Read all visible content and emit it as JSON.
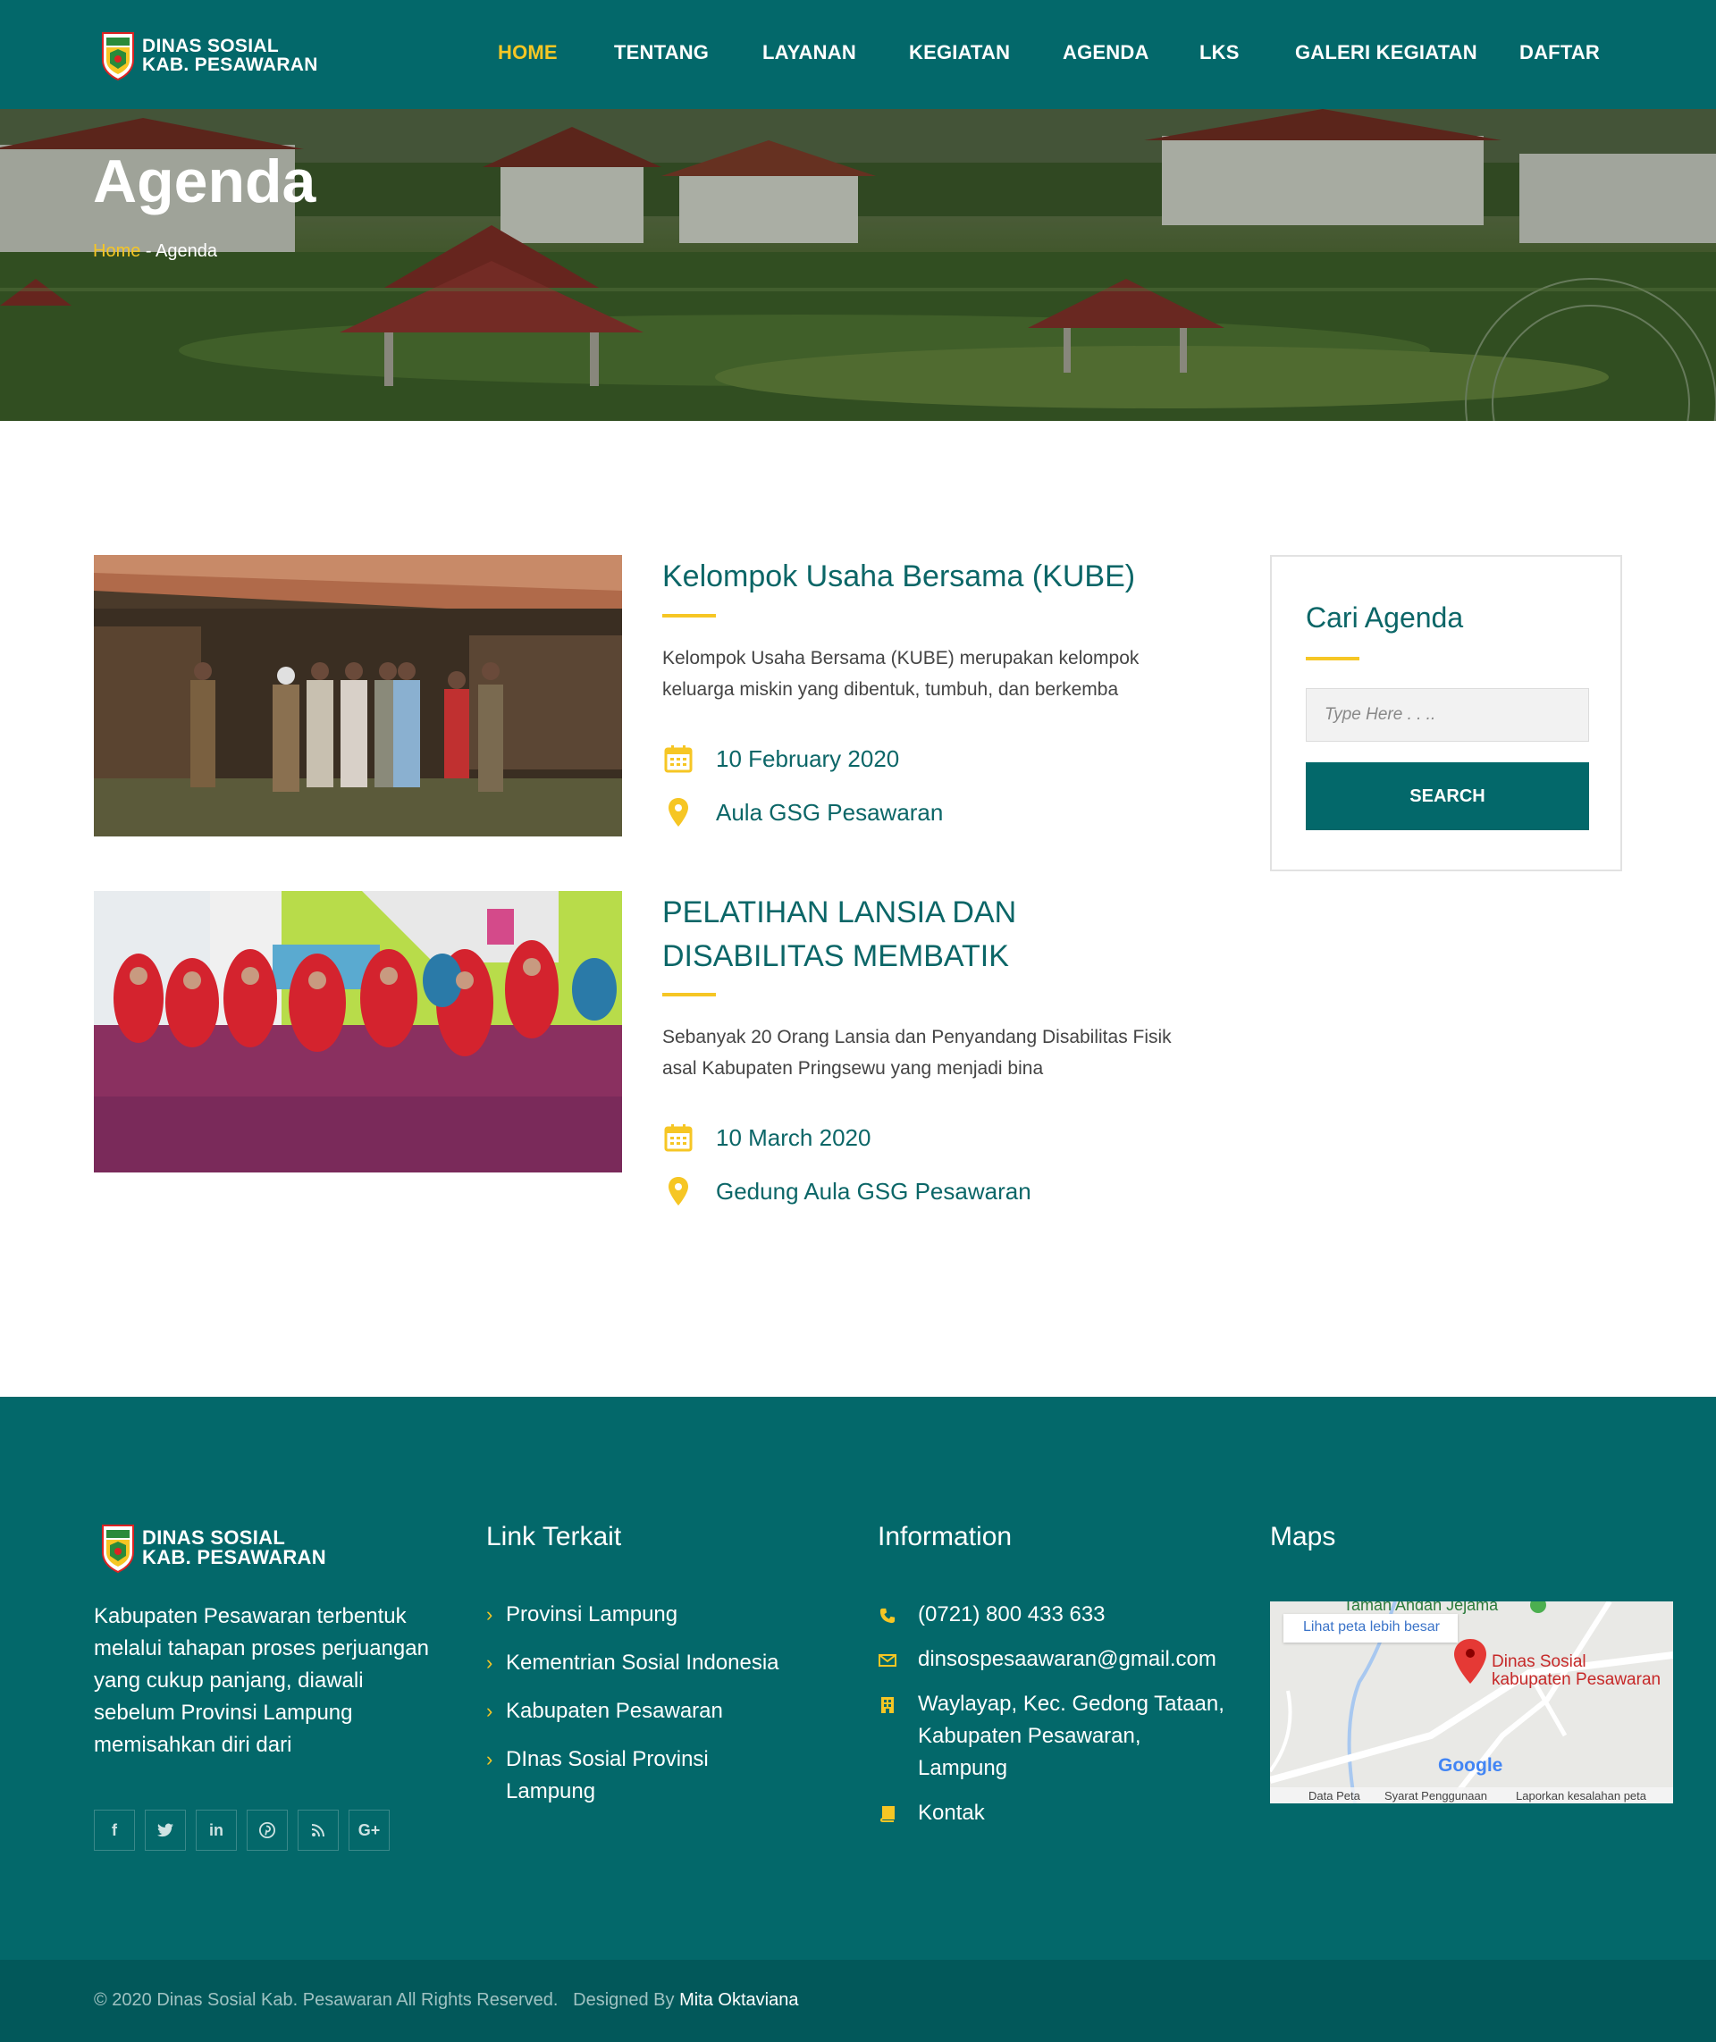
{
  "header": {
    "logo_line1": "DINAS SOSIAL",
    "logo_line2": "KAB. PESAWARAN",
    "nav": [
      "HOME",
      "TENTANG",
      "LAYANAN",
      "KEGIATAN",
      "AGENDA",
      "LKS",
      "GALERI KEGIATAN",
      "DAFTAR"
    ],
    "active_nav": "HOME"
  },
  "hero": {
    "title": "Agenda",
    "breadcrumb_home": "Home",
    "breadcrumb_sep": " - ",
    "breadcrumb_current": "Agenda"
  },
  "agenda": [
    {
      "title": "Kelompok Usaha Bersama (KUBE)",
      "description": "Kelompok Usaha Bersama (KUBE) merupakan kelompok keluarga miskin yang dibentuk, tumbuh, dan berkemba",
      "date": "10 February 2020",
      "location": "Aula GSG Pesawaran"
    },
    {
      "title": "PELATIHAN LANSIA DAN DISABILITAS MEMBATIK",
      "description": "Sebanyak 20 Orang Lansia dan Penyandang Disabilitas Fisik asal Kabupaten Pringsewu yang menjadi bina",
      "date": "10 March 2020",
      "location": "Gedung Aula GSG Pesawaran"
    }
  ],
  "sidebar": {
    "title": "Cari Agenda",
    "search_placeholder": "Type Here . . ..",
    "search_button": "SEARCH"
  },
  "footer": {
    "logo_line1": "DINAS SOSIAL",
    "logo_line2": "KAB. PESAWARAN",
    "about": "Kabupaten Pesawaran terbentuk melalui tahapan proses perjuangan yang cukup panjang, diawali sebelum Provinsi Lampung memisahkan diri dari",
    "socials": [
      "facebook-icon",
      "twitter-icon",
      "linkedin-icon",
      "pinterest-icon",
      "rss-icon",
      "google-plus-icon"
    ],
    "links_title": "Link Terkait",
    "links": [
      "Provinsi Lampung",
      "Kementrian Sosial Indonesia",
      "Kabupaten Pesawaran",
      "DInas Sosial Provinsi Lampung"
    ],
    "info_title": "Information",
    "info": {
      "phone": "(0721) 800 433 633",
      "email": "dinsospesaawaran@gmail.com",
      "address": "Waylayap, Kec. Gedong Tataan, Kabupaten Pesawaran, Lampung",
      "contact": "Kontak"
    },
    "maps_title": "Maps",
    "map": {
      "top_label": "Taman Andan Jejama",
      "view_larger": "Lihat peta lebih besar",
      "pin_label_1": "Dinas Sosial",
      "pin_label_2": "kabupaten Pesawaran",
      "google": "Google",
      "data_peta": "Data Peta",
      "syarat": "Syarat Penggunaan",
      "laporkan": "Laporkan kesalahan peta"
    }
  },
  "copyright": {
    "text": "© 2020 Dinas Sosial Kab. Pesawaran All Rights Reserved.   Designed By ",
    "author": "Mita Oktaviana"
  },
  "colors": {
    "primary": "#03686a",
    "accent": "#f6c624",
    "title": "#0b6667"
  }
}
